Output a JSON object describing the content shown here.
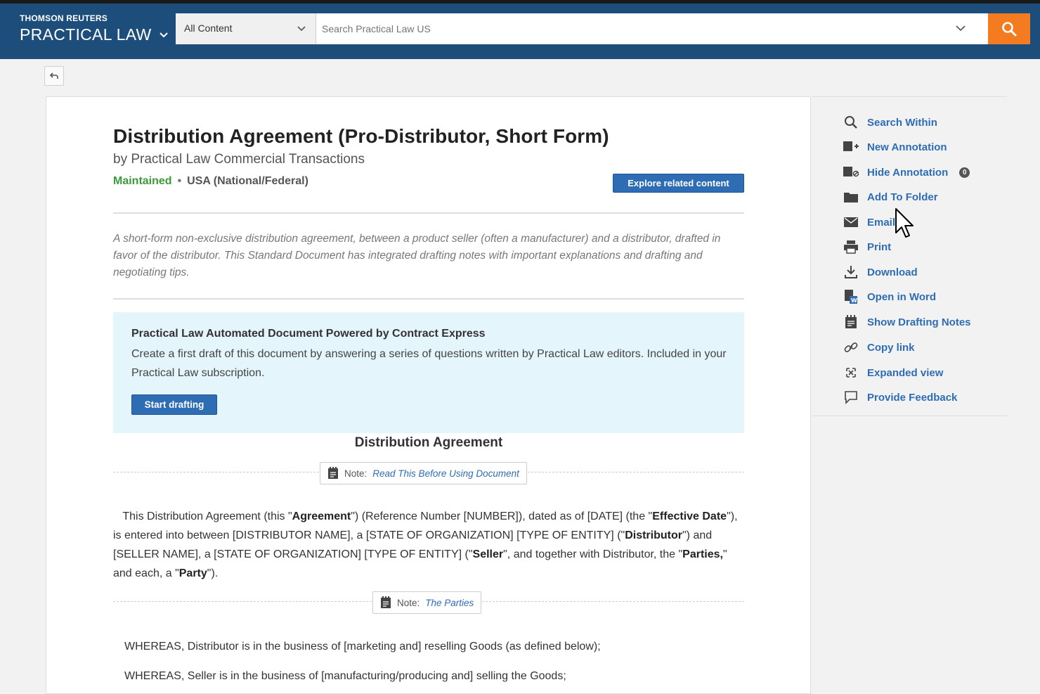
{
  "header": {
    "brand_small": "THOMSON REUTERS",
    "brand_big": "PRACTICAL LAW",
    "scope": "All Content",
    "search_placeholder": "Search Practical Law US"
  },
  "document": {
    "title": "Distribution Agreement (Pro-Distributor, Short Form)",
    "author": "by Practical Law Commercial Transactions",
    "status": "Maintained",
    "separator": "•",
    "jurisdiction": "USA (National/Federal)",
    "explore_label": "Explore related content",
    "summary": "A short-form non-exclusive distribution agreement, between a product seller (often a manufacturer) and a distributor, drafted in favor of the distributor. This Standard Document has integrated drafting notes with important explanations and drafting and negotiating tips.",
    "automated": {
      "title": "Practical Law Automated Document Powered by Contract Express",
      "text": "Create a first draft of this document by answering a series of questions written by Practical Law editors. Included in your Practical Law subscription.",
      "button": "Start drafting"
    },
    "section_heading": "Distribution Agreement",
    "note1": {
      "prefix": "Note:",
      "link": "Read This Before Using Document"
    },
    "note2": {
      "prefix": "Note:",
      "link": "The Parties"
    },
    "para1": {
      "t1": "This Distribution Agreement (this \"",
      "b1": "Agreement",
      "t2": "\") (Reference Number [NUMBER]), dated as of [DATE] (the \"",
      "b2": "Effective Date",
      "t3": "\"), is entered into between [DISTRIBUTOR NAME], a [STATE OF ORGANIZATION] [TYPE OF ENTITY] (\"",
      "b3": "Distributor",
      "t4": "\") and [SELLER NAME], a [STATE OF ORGANIZATION] [TYPE OF ENTITY] (\"",
      "b4": "Seller",
      "t5": "\", and together with Distributor, the \"",
      "b5": "Parties,",
      "t6": "\" and each, a \"",
      "b6": "Party",
      "t7": "\")."
    },
    "whereas1": "WHEREAS, Distributor is in the business of [marketing and] reselling Goods (as defined below);",
    "whereas2": "WHEREAS, Seller is in the business of [manufacturing/producing and] selling the Goods;"
  },
  "tools": {
    "search_within": "Search Within",
    "new_annotation": "New Annotation",
    "hide_annotation": "Hide Annotation",
    "annotation_count": "0",
    "add_to_folder": "Add To Folder",
    "email": "Email",
    "print": "Print",
    "download": "Download",
    "open_in_word": "Open in Word",
    "show_drafting_notes": "Show Drafting Notes",
    "copy_link": "Copy link",
    "expanded_view": "Expanded view",
    "provide_feedback": "Provide Feedback"
  },
  "colors": {
    "header_bg": "#1d4d7a",
    "accent_orange": "#f47b20",
    "link_blue": "#2e6db4",
    "maintained_green": "#3c9a3c",
    "info_box_bg": "#e4f5fb"
  }
}
